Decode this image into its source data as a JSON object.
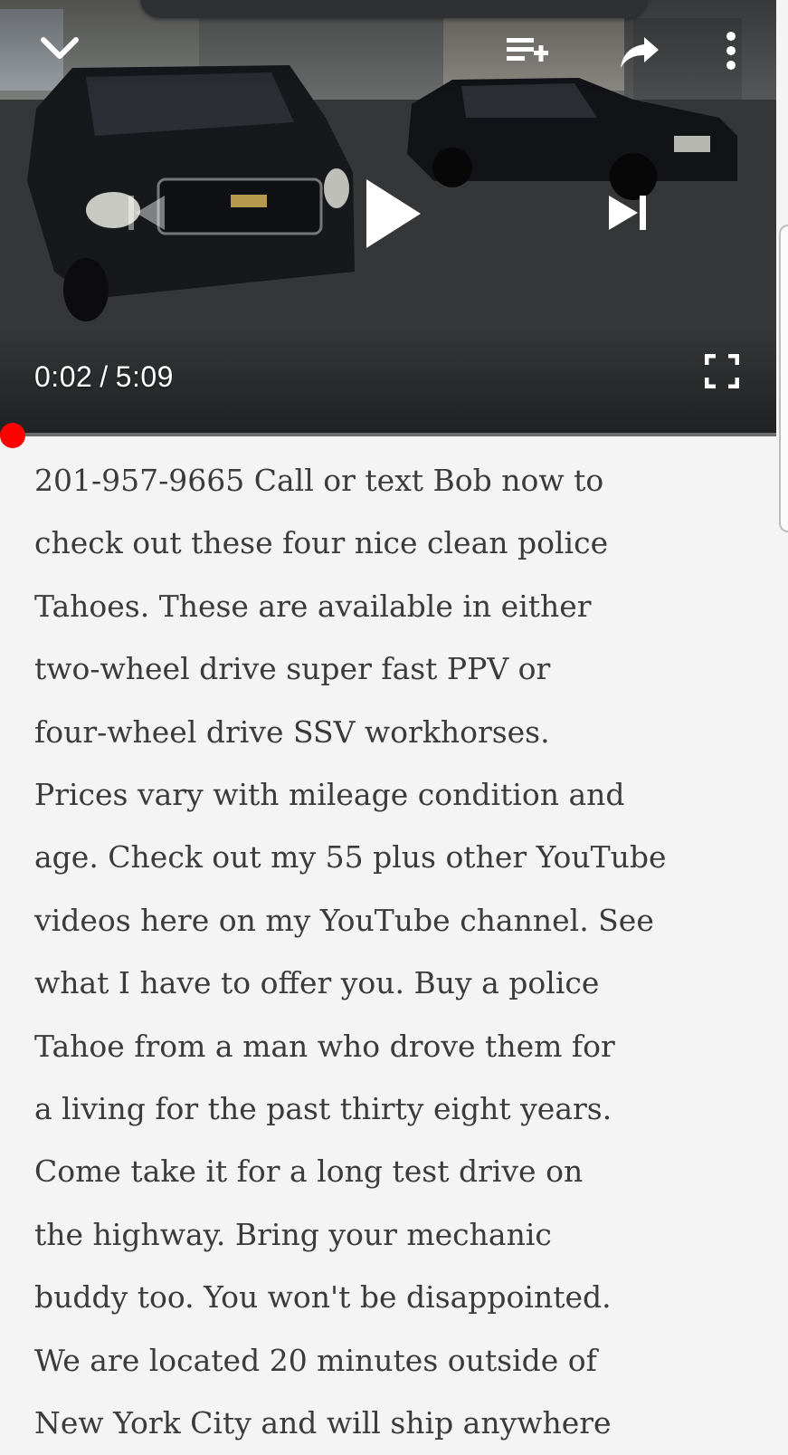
{
  "player": {
    "current_time": "0:02",
    "separator": "/",
    "duration": "5:09",
    "progress_fraction": 0.0065,
    "icons": {
      "collapse": "chevron-down-icon",
      "add_to_playlist": "playlist-add-icon",
      "share": "share-icon",
      "more": "more-vert-icon",
      "previous": "skip-previous-icon",
      "play": "play-icon",
      "next": "skip-next-icon",
      "fullscreen": "fullscreen-icon"
    },
    "accent_color": "#ff0000"
  },
  "description": {
    "text": "201-957-9665 Call or text Bob now to\ncheck out these four nice clean police\nTahoes. These are available in either\ntwo-wheel drive super fast PPV or\nfour-wheel drive SSV workhorses.\nPrices vary with mileage condition and\nage. Check out my 55 plus other YouTube\nvideos here on my YouTube channel. See\nwhat I have to offer you. Buy a police\nTahoe from a man who drove them for\na living for the past thirty eight years.\nCome take it for a long test drive on\nthe highway. Bring your mechanic\nbuddy too. You won't be disappointed.\nWe are located 20 minutes outside of\nNew York City and will ship anywhere"
  }
}
